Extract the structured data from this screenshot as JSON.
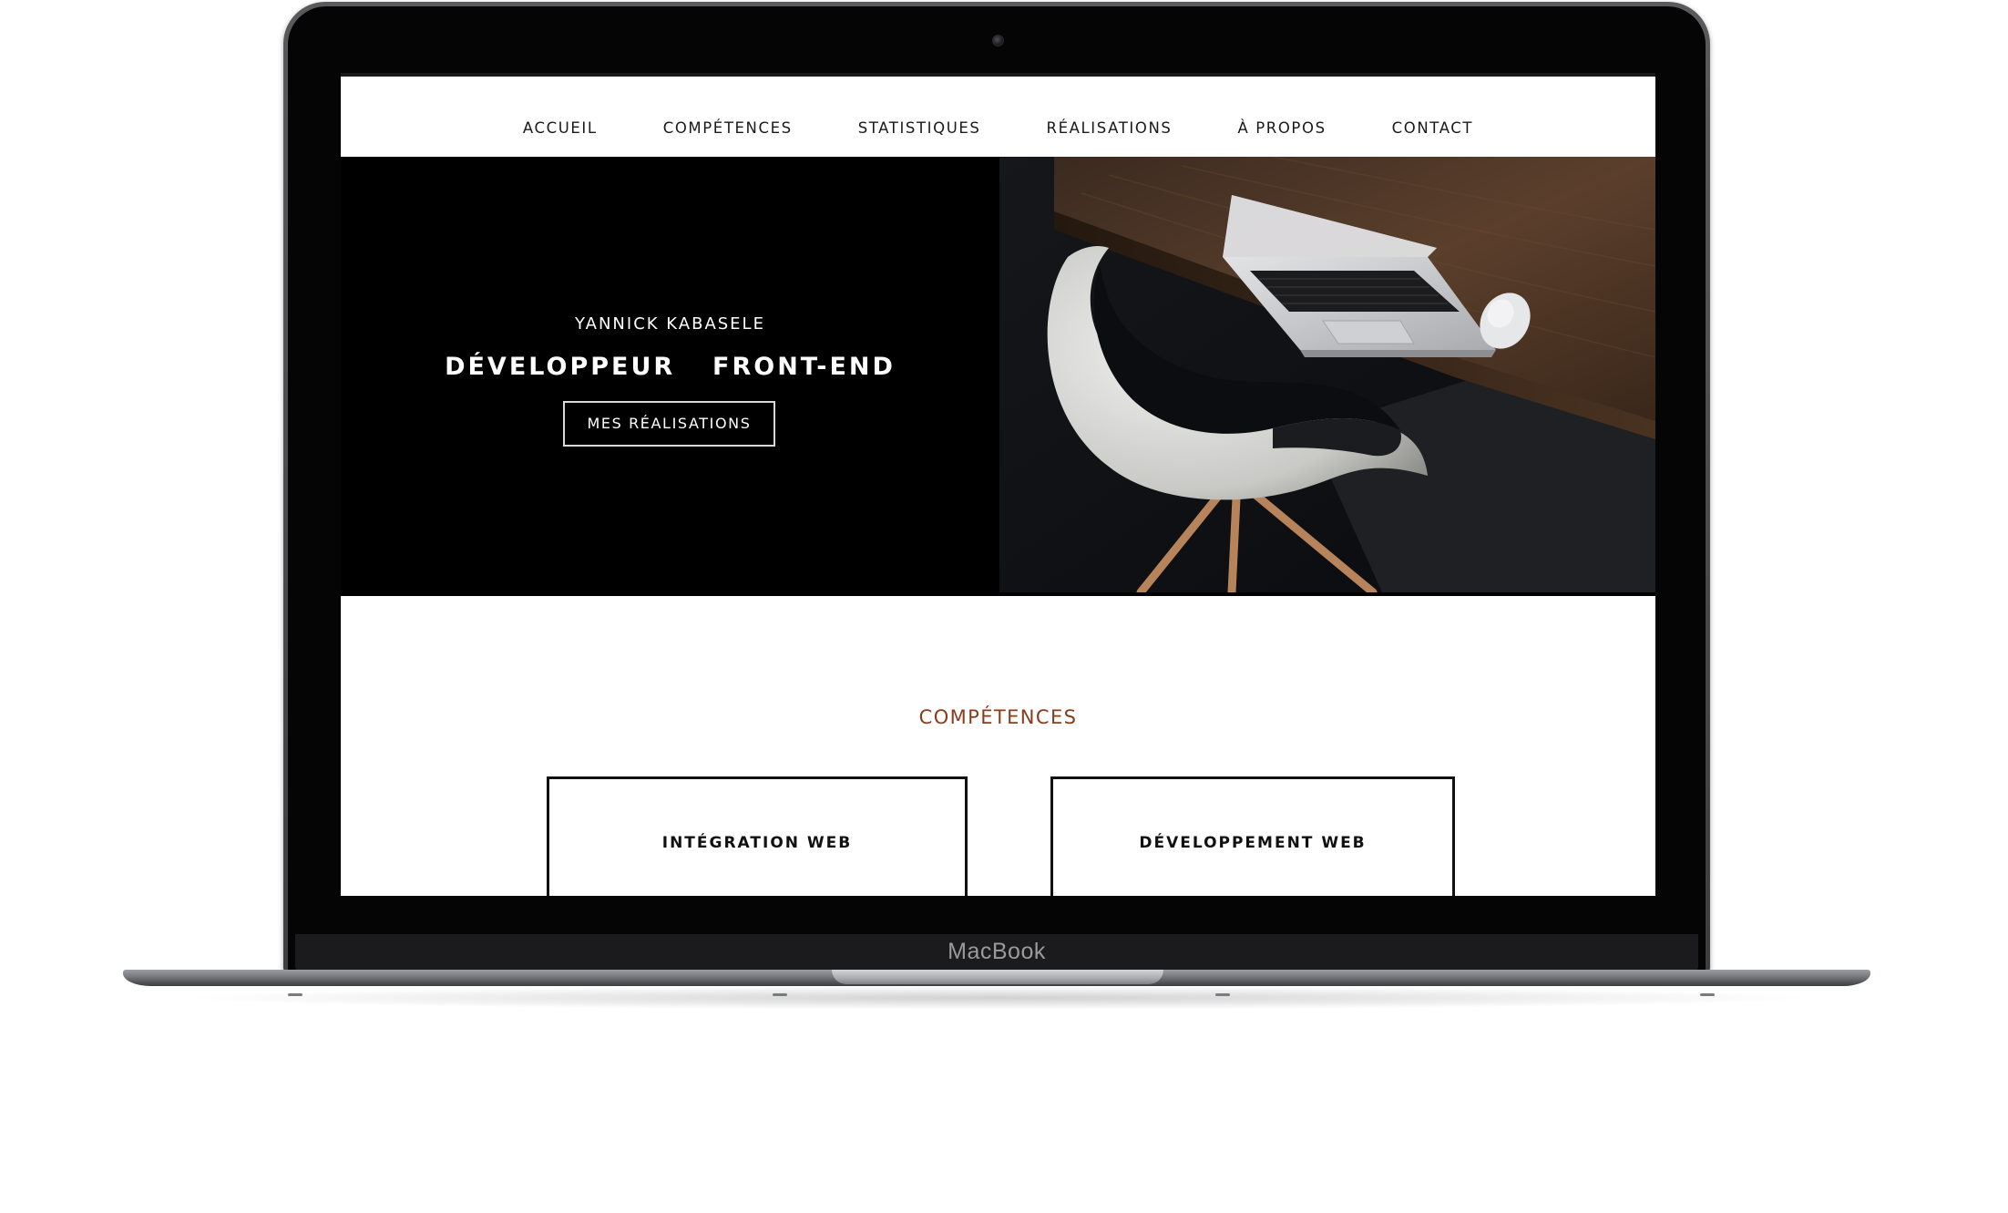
{
  "device": {
    "brand_label": "MacBook"
  },
  "nav": {
    "items": [
      {
        "label": "ACCUEIL"
      },
      {
        "label": "COMPÉTENCES"
      },
      {
        "label": "STATISTIQUES"
      },
      {
        "label": "RÉALISATIONS"
      },
      {
        "label": "À PROPOS"
      },
      {
        "label": "CONTACT"
      }
    ]
  },
  "hero": {
    "name": "YANNICK KABASELE",
    "title": "DÉVELOPPEUR  FRONT-END",
    "button_label": "MES RÉALISATIONS",
    "photo_icon": "desk-laptop-chair-photo"
  },
  "competences": {
    "section_title": "COMPÉTENCES",
    "cards": [
      {
        "title": "INTÉGRATION WEB"
      },
      {
        "title": "DÉVELOPPEMENT WEB"
      }
    ]
  },
  "colors": {
    "accent": "#8a3b1a",
    "hero_bg": "#000000",
    "nav_text": "#1a1a1a"
  }
}
